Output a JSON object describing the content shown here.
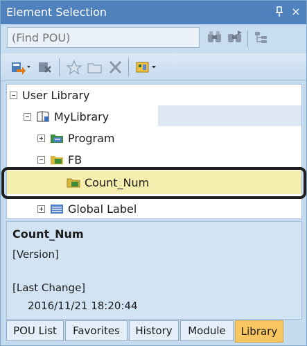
{
  "window": {
    "title": "Element Selection",
    "pin_glyph": "ѱ",
    "close_glyph": "×"
  },
  "search": {
    "placeholder": "(Find POU)",
    "value": ""
  },
  "search_buttons": [
    "binoculars-icon",
    "binoculars-next-icon",
    "tree-view-icon"
  ],
  "toolbar": {
    "tools": [
      "add-to-project-icon",
      "remove-library-icon",
      "favorite-star-icon",
      "folder-icon",
      "delete-x-icon",
      "display-filter-icon"
    ]
  },
  "tree": {
    "root": {
      "label": "User Library",
      "expanded": true
    },
    "library": {
      "label": "MyLibrary",
      "expanded": true
    },
    "program": {
      "label": "Program",
      "expanded": false
    },
    "fb": {
      "label": "FB",
      "expanded": true
    },
    "count_num": {
      "label": "Count_Num",
      "selected": true
    },
    "global_label": {
      "label": "Global Label",
      "expanded": false
    }
  },
  "details": {
    "name": "Count_Num",
    "version_label": "[Version]",
    "last_change_label": "[Last Change]",
    "last_change_value": "2016/11/21 18:20:44"
  },
  "tabs": [
    {
      "label": "POU List",
      "active": false
    },
    {
      "label": "Favorites",
      "active": false
    },
    {
      "label": "History",
      "active": false
    },
    {
      "label": "Module",
      "active": false
    },
    {
      "label": "Library",
      "active": true
    }
  ],
  "colors": {
    "title_bar": "#4f81bd",
    "panel": "#c3daef",
    "selection": "#f5eeae",
    "active_tab": "#f7c562",
    "highlight_border": "#1f1f1f"
  }
}
